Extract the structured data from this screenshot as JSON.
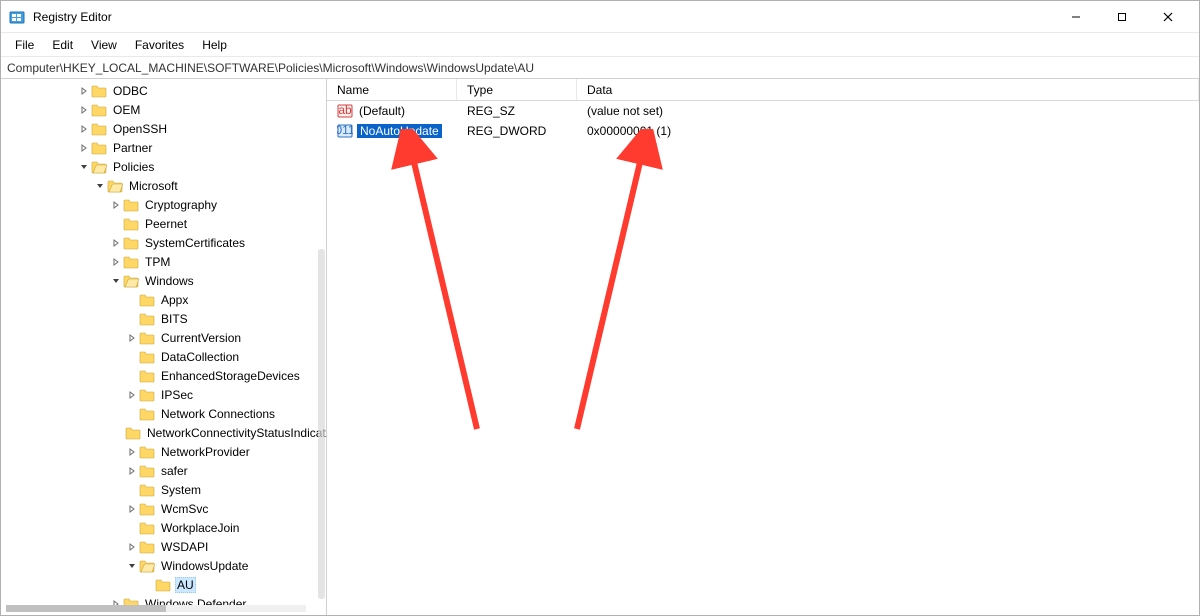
{
  "window": {
    "title": "Registry Editor"
  },
  "menubar": [
    "File",
    "Edit",
    "View",
    "Favorites",
    "Help"
  ],
  "address": "Computer\\HKEY_LOCAL_MACHINE\\SOFTWARE\\Policies\\Microsoft\\Windows\\WindowsUpdate\\AU",
  "columns": {
    "name": "Name",
    "type": "Type",
    "data": "Data"
  },
  "values": [
    {
      "icon": "string",
      "name": "(Default)",
      "type": "REG_SZ",
      "data": "(value not set)",
      "selected": false
    },
    {
      "icon": "dword",
      "name": "NoAutoUpdate",
      "type": "REG_DWORD",
      "data": "0x00000001 (1)",
      "selected": true
    }
  ],
  "tree": [
    {
      "label": "ODBC",
      "depth": 4,
      "twisty": "closed"
    },
    {
      "label": "OEM",
      "depth": 4,
      "twisty": "closed"
    },
    {
      "label": "OpenSSH",
      "depth": 4,
      "twisty": "closed"
    },
    {
      "label": "Partner",
      "depth": 4,
      "twisty": "closed"
    },
    {
      "label": "Policies",
      "depth": 4,
      "twisty": "open"
    },
    {
      "label": "Microsoft",
      "depth": 5,
      "twisty": "open"
    },
    {
      "label": "Cryptography",
      "depth": 6,
      "twisty": "closed"
    },
    {
      "label": "Peernet",
      "depth": 6,
      "twisty": "none"
    },
    {
      "label": "SystemCertificates",
      "depth": 6,
      "twisty": "closed"
    },
    {
      "label": "TPM",
      "depth": 6,
      "twisty": "closed"
    },
    {
      "label": "Windows",
      "depth": 6,
      "twisty": "open"
    },
    {
      "label": "Appx",
      "depth": 7,
      "twisty": "none"
    },
    {
      "label": "BITS",
      "depth": 7,
      "twisty": "none"
    },
    {
      "label": "CurrentVersion",
      "depth": 7,
      "twisty": "closed"
    },
    {
      "label": "DataCollection",
      "depth": 7,
      "twisty": "none"
    },
    {
      "label": "EnhancedStorageDevices",
      "depth": 7,
      "twisty": "none"
    },
    {
      "label": "IPSec",
      "depth": 7,
      "twisty": "closed"
    },
    {
      "label": "Network Connections",
      "depth": 7,
      "twisty": "none"
    },
    {
      "label": "NetworkConnectivityStatusIndicator",
      "depth": 7,
      "twisty": "none"
    },
    {
      "label": "NetworkProvider",
      "depth": 7,
      "twisty": "closed"
    },
    {
      "label": "safer",
      "depth": 7,
      "twisty": "closed"
    },
    {
      "label": "System",
      "depth": 7,
      "twisty": "none"
    },
    {
      "label": "WcmSvc",
      "depth": 7,
      "twisty": "closed"
    },
    {
      "label": "WorkplaceJoin",
      "depth": 7,
      "twisty": "none"
    },
    {
      "label": "WSDAPI",
      "depth": 7,
      "twisty": "closed"
    },
    {
      "label": "WindowsUpdate",
      "depth": 7,
      "twisty": "open"
    },
    {
      "label": "AU",
      "depth": 8,
      "twisty": "none",
      "selected": true
    },
    {
      "label": "Windows Defender",
      "depth": 6,
      "twisty": "closed"
    }
  ],
  "icons": {
    "folder_closed_fill": "#ffd766",
    "folder_closed_stroke": "#caa637",
    "folder_open_fill": "#ffe9a6",
    "value_string_bg": "#fdeeee",
    "value_string_acc": "#d24040",
    "value_dword_bg": "#dbe9fb",
    "value_dword_acc": "#2c73c6",
    "arrow_color": "#ff3b2f"
  }
}
